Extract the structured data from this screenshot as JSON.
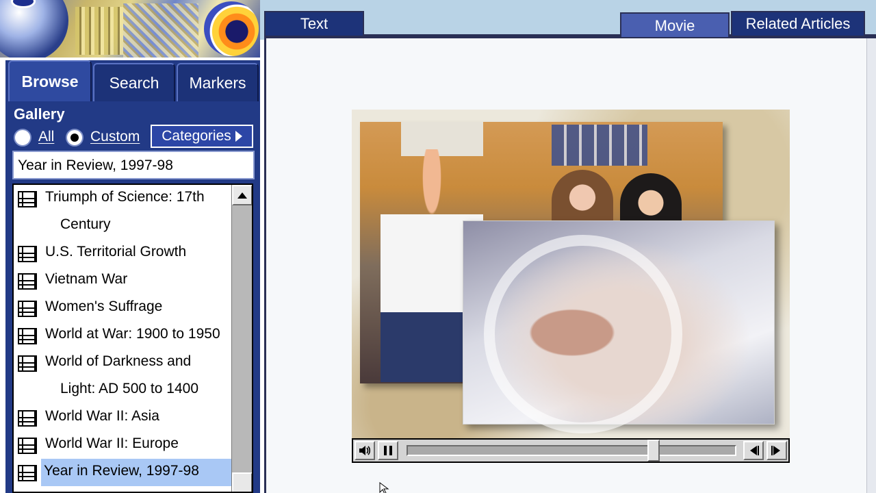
{
  "left_tabs": {
    "browse": "Browse",
    "search": "Search",
    "markers": "Markers"
  },
  "gallery": {
    "label": "Gallery",
    "radio_all": "All",
    "radio_custom": "Custom",
    "selected_radio": "Custom",
    "categories_button": "Categories",
    "current_category": "Year in Review, 1997-98"
  },
  "list": {
    "items": [
      {
        "line1": "Triumph of Science: 17th",
        "line2": "Century"
      },
      {
        "line1": "U.S. Territorial Growth",
        "line2": ""
      },
      {
        "line1": "Vietnam War",
        "line2": ""
      },
      {
        "line1": "Women's Suffrage",
        "line2": ""
      },
      {
        "line1": "World at War: 1900 to 1950",
        "line2": ""
      },
      {
        "line1": "World of Darkness and",
        "line2": "Light: AD 500 to 1400"
      },
      {
        "line1": "World War II: Asia",
        "line2": ""
      },
      {
        "line1": "World War II: Europe",
        "line2": ""
      },
      {
        "line1": "Year in Review, 1997-98",
        "line2": ""
      }
    ],
    "selected_index": 8,
    "scroll_position": 1.0
  },
  "top_tabs": {
    "text": "Text",
    "movie": "Movie",
    "related": "Related Articles",
    "active": "Movie"
  },
  "player": {
    "volume_icon": "speaker-icon",
    "pause_icon": "pause-icon",
    "step_back_icon": "step-back-icon",
    "step_forward_icon": "step-forward-icon",
    "progress": 0.76
  },
  "colors": {
    "panel": "#223a86",
    "tab": "#1d3379",
    "tab_active": "#4a5fb0",
    "selection": "#a9c8f5",
    "header_band": "#b9d3e6"
  }
}
